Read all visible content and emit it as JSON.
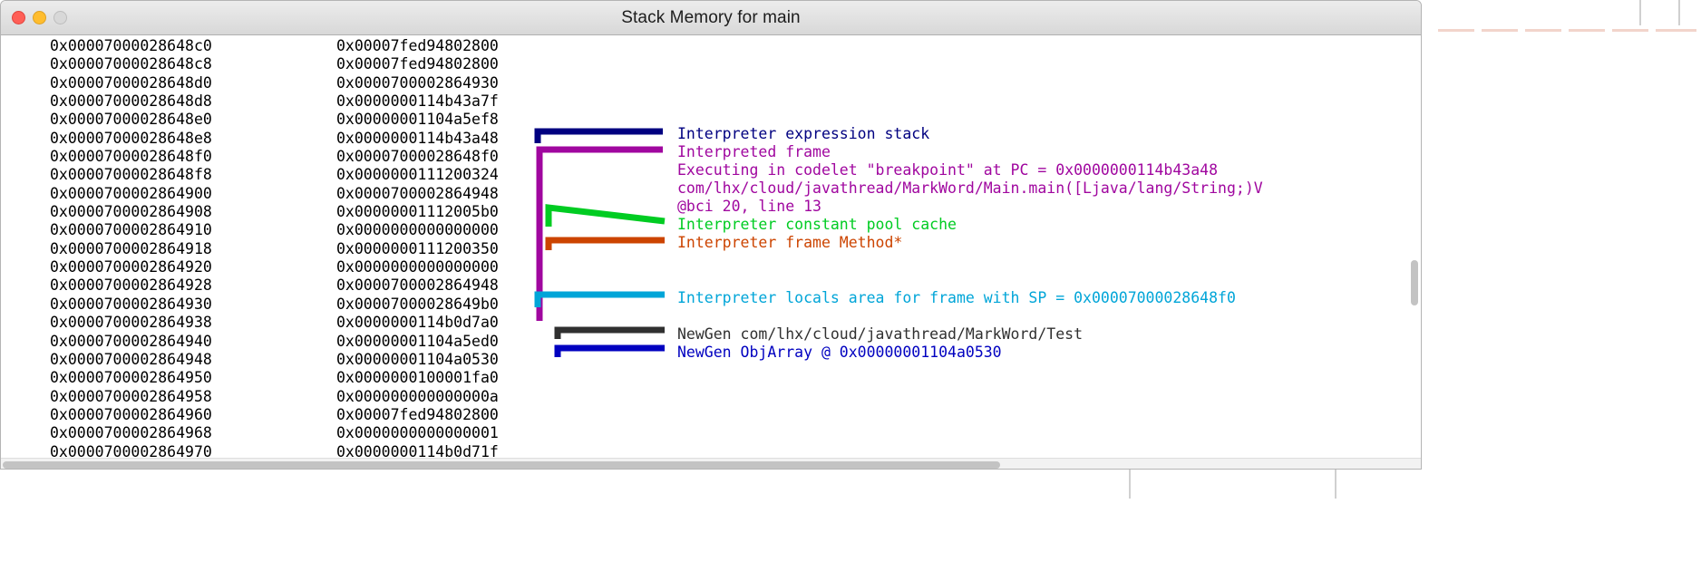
{
  "window": {
    "title": "Stack Memory for main",
    "traffic_lights": [
      {
        "name": "close",
        "color": "#ff5f57"
      },
      {
        "name": "minimize",
        "color": "#ffbd2e"
      },
      {
        "name": "zoom",
        "color": "#d8d8d8"
      }
    ]
  },
  "colors": {
    "navy": "#000080",
    "purple": "#a0079f",
    "green": "#00cc22",
    "orange": "#cc4400",
    "cyan": "#00a5d8",
    "black": "#000000",
    "blue": "#0000c0",
    "text": "#000000"
  },
  "memory": {
    "rows": [
      {
        "address": "0x00007000028648c0",
        "value": "0x00007fed94802800"
      },
      {
        "address": "0x00007000028648c8",
        "value": "0x00007fed94802800"
      },
      {
        "address": "0x00007000028648d0",
        "value": "0x0000700002864930"
      },
      {
        "address": "0x00007000028648d8",
        "value": "0x0000000114b43a7f"
      },
      {
        "address": "0x00007000028648e0",
        "value": "0x00000001104a5ef8"
      },
      {
        "address": "0x00007000028648e8",
        "value": "0x0000000114b43a48"
      },
      {
        "address": "0x00007000028648f0",
        "value": "0x00007000028648f0"
      },
      {
        "address": "0x00007000028648f8",
        "value": "0x0000000111200324"
      },
      {
        "address": "0x0000700002864900",
        "value": "0x0000700002864948"
      },
      {
        "address": "0x0000700002864908",
        "value": "0x00000001112005b0"
      },
      {
        "address": "0x0000700002864910",
        "value": "0x0000000000000000"
      },
      {
        "address": "0x0000700002864918",
        "value": "0x0000000111200350"
      },
      {
        "address": "0x0000700002864920",
        "value": "0x0000000000000000"
      },
      {
        "address": "0x0000700002864928",
        "value": "0x0000700002864948"
      },
      {
        "address": "0x0000700002864930",
        "value": "0x00007000028649b0"
      },
      {
        "address": "0x0000700002864938",
        "value": "0x0000000114b0d7a0"
      },
      {
        "address": "0x0000700002864940",
        "value": "0x00000001104a5ed0"
      },
      {
        "address": "0x0000700002864948",
        "value": "0x00000001104a0530"
      },
      {
        "address": "0x0000700002864950",
        "value": "0x0000000100001fa0"
      },
      {
        "address": "0x0000700002864958",
        "value": "0x000000000000000a"
      },
      {
        "address": "0x0000700002864960",
        "value": "0x00007fed94802800"
      },
      {
        "address": "0x0000700002864968",
        "value": "0x0000000000000001"
      },
      {
        "address": "0x0000700002864970",
        "value": "0x0000000114b0d71f"
      }
    ]
  },
  "annotations": [
    {
      "id": "interpreter-expression-stack",
      "label": "Interpreter expression stack",
      "color": "#000080",
      "bracket": "top-right"
    },
    {
      "id": "interpreted-frame",
      "label": "Interpreted frame",
      "color": "#a0079f",
      "bracket": "tall-left"
    },
    {
      "id": "executing-codelet",
      "label": "Executing in codelet \"breakpoint\" at PC = 0x0000000114b43a48",
      "color": "#a0079f"
    },
    {
      "id": "main-method-signature",
      "label": "com/lhx/cloud/javathread/MarkWord/Main.main([Ljava/lang/String;)V",
      "color": "#a0079f"
    },
    {
      "id": "bci-line",
      "label": "@bci 20, line 13",
      "color": "#a0079f"
    },
    {
      "id": "interpreter-constant-pool-cache",
      "label": "Interpreter constant pool cache",
      "color": "#00cc22",
      "bracket": "slanted"
    },
    {
      "id": "interpreter-frame-method",
      "label": "Interpreter frame Method*",
      "color": "#cc4400",
      "bracket": "flat"
    },
    {
      "id": "interpreter-locals-area",
      "label": "Interpreter locals area for frame with SP = 0x00007000028648f0",
      "color": "#00a5d8",
      "bracket": "flat"
    },
    {
      "id": "newgen-test",
      "label": "NewGen com/lhx/cloud/javathread/MarkWord/Test",
      "color": "#303030",
      "bracket": "flat"
    },
    {
      "id": "newgen-objarray",
      "label": "NewGen ObjArray @ 0x00000001104a0530",
      "color": "#0000c0",
      "bracket": "flat"
    }
  ]
}
